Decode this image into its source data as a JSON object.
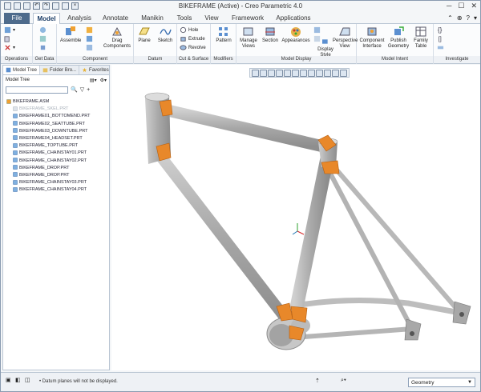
{
  "window": {
    "title": "BIKEFRAME (Active) - Creo Parametric 4.0"
  },
  "tabs": [
    {
      "label": "File"
    },
    {
      "label": "Model"
    },
    {
      "label": "Analysis"
    },
    {
      "label": "Annotate"
    },
    {
      "label": "Manikin"
    },
    {
      "label": "Tools"
    },
    {
      "label": "View"
    },
    {
      "label": "Framework"
    },
    {
      "label": "Applications"
    }
  ],
  "ribbon": {
    "groups": {
      "operations": "Operations",
      "get_data": "Get Data",
      "component": "Component",
      "datum": "Datum",
      "cut_surface": "Cut & Surface",
      "modifiers": "Modifiers",
      "model_display": "Model Display",
      "model_intent": "Model Intent",
      "investigate": "Investigate"
    },
    "buttons": {
      "assemble": "Assemble",
      "drag_components_1": "Drag",
      "drag_components_2": "Components",
      "plane": "Plane",
      "sketch": "Sketch",
      "hole": "Hole",
      "extrude": "Extrude",
      "revolve": "Revolve",
      "pattern": "Pattern",
      "manage_views_1": "Manage",
      "manage_views_2": "Views",
      "section": "Section",
      "appearances": "Appearances",
      "display_style_1": "Display",
      "display_style_2": "Style",
      "perspective_view_1": "Perspective",
      "perspective_view_2": "View",
      "component_interface_1": "Component",
      "component_interface_2": "Interface",
      "publish_geometry_1": "Publish",
      "publish_geometry_2": "Geometry",
      "family_table_1": "Family",
      "family_table_2": "Table"
    }
  },
  "panel": {
    "tabs": [
      "Model Tree",
      "Folder Bro...",
      "Favorites"
    ],
    "header": "Model Tree",
    "tree": {
      "root": "BIKEFRAME.ASM",
      "items": [
        {
          "label": "BIKEFRAME_SKEL.PRT",
          "dim": true
        },
        {
          "label": "BIKEFRAME01_BOTTOMEND.PRT",
          "dim": false
        },
        {
          "label": "BIKEFRAME02_SEATTUBE.PRT",
          "dim": false
        },
        {
          "label": "BIKEFRAME03_DOWNTUBE.PRT",
          "dim": false
        },
        {
          "label": "BIKEFRAME04_HEADSET.PRT",
          "dim": false
        },
        {
          "label": "BIKEFRAME_TOPTUBE.PRT",
          "dim": false
        },
        {
          "label": "BIKEFRAME_CHAINSTAY01.PRT",
          "dim": false
        },
        {
          "label": "BIKEFRAME_CHAINSTAY02.PRT",
          "dim": false
        },
        {
          "label": "BIKEFRAME_DROP.PRT",
          "dim": false
        },
        {
          "label": "BIKEFRAME_DROP.PRT",
          "dim": false
        },
        {
          "label": "BIKEFRAME_CHAINSTAY03.PRT",
          "dim": false
        },
        {
          "label": "BIKEFRAME_CHAINSTAY04.PRT",
          "dim": false
        }
      ]
    }
  },
  "status": {
    "message": "• Datum planes will not be displayed.",
    "filter_value": "Geometry"
  },
  "colors": {
    "file_tab": "#4e6b8c",
    "tube": "#b8b8b8",
    "joint": "#e8882a"
  },
  "icons": [
    "search-icon",
    "settings-icon",
    "filter-icon",
    "add-icon"
  ]
}
